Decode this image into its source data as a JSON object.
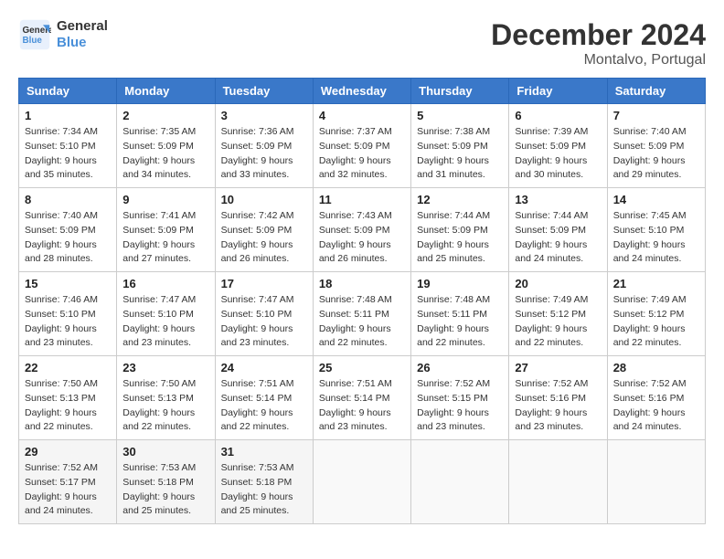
{
  "header": {
    "logo_line1": "General",
    "logo_line2": "Blue",
    "month": "December 2024",
    "location": "Montalvo, Portugal"
  },
  "weekdays": [
    "Sunday",
    "Monday",
    "Tuesday",
    "Wednesday",
    "Thursday",
    "Friday",
    "Saturday"
  ],
  "weeks": [
    [
      {
        "day": "1",
        "sunrise": "7:34 AM",
        "sunset": "5:10 PM",
        "daylight": "9 hours and 35 minutes."
      },
      {
        "day": "2",
        "sunrise": "7:35 AM",
        "sunset": "5:09 PM",
        "daylight": "9 hours and 34 minutes."
      },
      {
        "day": "3",
        "sunrise": "7:36 AM",
        "sunset": "5:09 PM",
        "daylight": "9 hours and 33 minutes."
      },
      {
        "day": "4",
        "sunrise": "7:37 AM",
        "sunset": "5:09 PM",
        "daylight": "9 hours and 32 minutes."
      },
      {
        "day": "5",
        "sunrise": "7:38 AM",
        "sunset": "5:09 PM",
        "daylight": "9 hours and 31 minutes."
      },
      {
        "day": "6",
        "sunrise": "7:39 AM",
        "sunset": "5:09 PM",
        "daylight": "9 hours and 30 minutes."
      },
      {
        "day": "7",
        "sunrise": "7:40 AM",
        "sunset": "5:09 PM",
        "daylight": "9 hours and 29 minutes."
      }
    ],
    [
      {
        "day": "8",
        "sunrise": "7:40 AM",
        "sunset": "5:09 PM",
        "daylight": "9 hours and 28 minutes."
      },
      {
        "day": "9",
        "sunrise": "7:41 AM",
        "sunset": "5:09 PM",
        "daylight": "9 hours and 27 minutes."
      },
      {
        "day": "10",
        "sunrise": "7:42 AM",
        "sunset": "5:09 PM",
        "daylight": "9 hours and 26 minutes."
      },
      {
        "day": "11",
        "sunrise": "7:43 AM",
        "sunset": "5:09 PM",
        "daylight": "9 hours and 26 minutes."
      },
      {
        "day": "12",
        "sunrise": "7:44 AM",
        "sunset": "5:09 PM",
        "daylight": "9 hours and 25 minutes."
      },
      {
        "day": "13",
        "sunrise": "7:44 AM",
        "sunset": "5:09 PM",
        "daylight": "9 hours and 24 minutes."
      },
      {
        "day": "14",
        "sunrise": "7:45 AM",
        "sunset": "5:10 PM",
        "daylight": "9 hours and 24 minutes."
      }
    ],
    [
      {
        "day": "15",
        "sunrise": "7:46 AM",
        "sunset": "5:10 PM",
        "daylight": "9 hours and 23 minutes."
      },
      {
        "day": "16",
        "sunrise": "7:47 AM",
        "sunset": "5:10 PM",
        "daylight": "9 hours and 23 minutes."
      },
      {
        "day": "17",
        "sunrise": "7:47 AM",
        "sunset": "5:10 PM",
        "daylight": "9 hours and 23 minutes."
      },
      {
        "day": "18",
        "sunrise": "7:48 AM",
        "sunset": "5:11 PM",
        "daylight": "9 hours and 22 minutes."
      },
      {
        "day": "19",
        "sunrise": "7:48 AM",
        "sunset": "5:11 PM",
        "daylight": "9 hours and 22 minutes."
      },
      {
        "day": "20",
        "sunrise": "7:49 AM",
        "sunset": "5:12 PM",
        "daylight": "9 hours and 22 minutes."
      },
      {
        "day": "21",
        "sunrise": "7:49 AM",
        "sunset": "5:12 PM",
        "daylight": "9 hours and 22 minutes."
      }
    ],
    [
      {
        "day": "22",
        "sunrise": "7:50 AM",
        "sunset": "5:13 PM",
        "daylight": "9 hours and 22 minutes."
      },
      {
        "day": "23",
        "sunrise": "7:50 AM",
        "sunset": "5:13 PM",
        "daylight": "9 hours and 22 minutes."
      },
      {
        "day": "24",
        "sunrise": "7:51 AM",
        "sunset": "5:14 PM",
        "daylight": "9 hours and 22 minutes."
      },
      {
        "day": "25",
        "sunrise": "7:51 AM",
        "sunset": "5:14 PM",
        "daylight": "9 hours and 23 minutes."
      },
      {
        "day": "26",
        "sunrise": "7:52 AM",
        "sunset": "5:15 PM",
        "daylight": "9 hours and 23 minutes."
      },
      {
        "day": "27",
        "sunrise": "7:52 AM",
        "sunset": "5:16 PM",
        "daylight": "9 hours and 23 minutes."
      },
      {
        "day": "28",
        "sunrise": "7:52 AM",
        "sunset": "5:16 PM",
        "daylight": "9 hours and 24 minutes."
      }
    ],
    [
      {
        "day": "29",
        "sunrise": "7:52 AM",
        "sunset": "5:17 PM",
        "daylight": "9 hours and 24 minutes."
      },
      {
        "day": "30",
        "sunrise": "7:53 AM",
        "sunset": "5:18 PM",
        "daylight": "9 hours and 25 minutes."
      },
      {
        "day": "31",
        "sunrise": "7:53 AM",
        "sunset": "5:18 PM",
        "daylight": "9 hours and 25 minutes."
      },
      null,
      null,
      null,
      null
    ]
  ]
}
